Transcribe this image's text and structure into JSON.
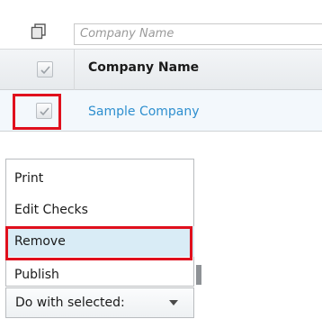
{
  "grid": {
    "filter_placeholder": "Company Name",
    "column_header": "Company Name",
    "rows": [
      {
        "company_name": "Sample Company",
        "selected": true
      }
    ]
  },
  "menu": {
    "items": [
      {
        "label": "Print"
      },
      {
        "label": "Edit Checks"
      },
      {
        "label": "Remove"
      },
      {
        "label": "Publish"
      }
    ],
    "highlighted": "Remove"
  },
  "actions": {
    "do_with_selected_label": "Do with selected:"
  },
  "colors": {
    "link": "#2e8fcf",
    "highlight_border": "#e0101d",
    "menu_hover": "#d9ecf6"
  }
}
